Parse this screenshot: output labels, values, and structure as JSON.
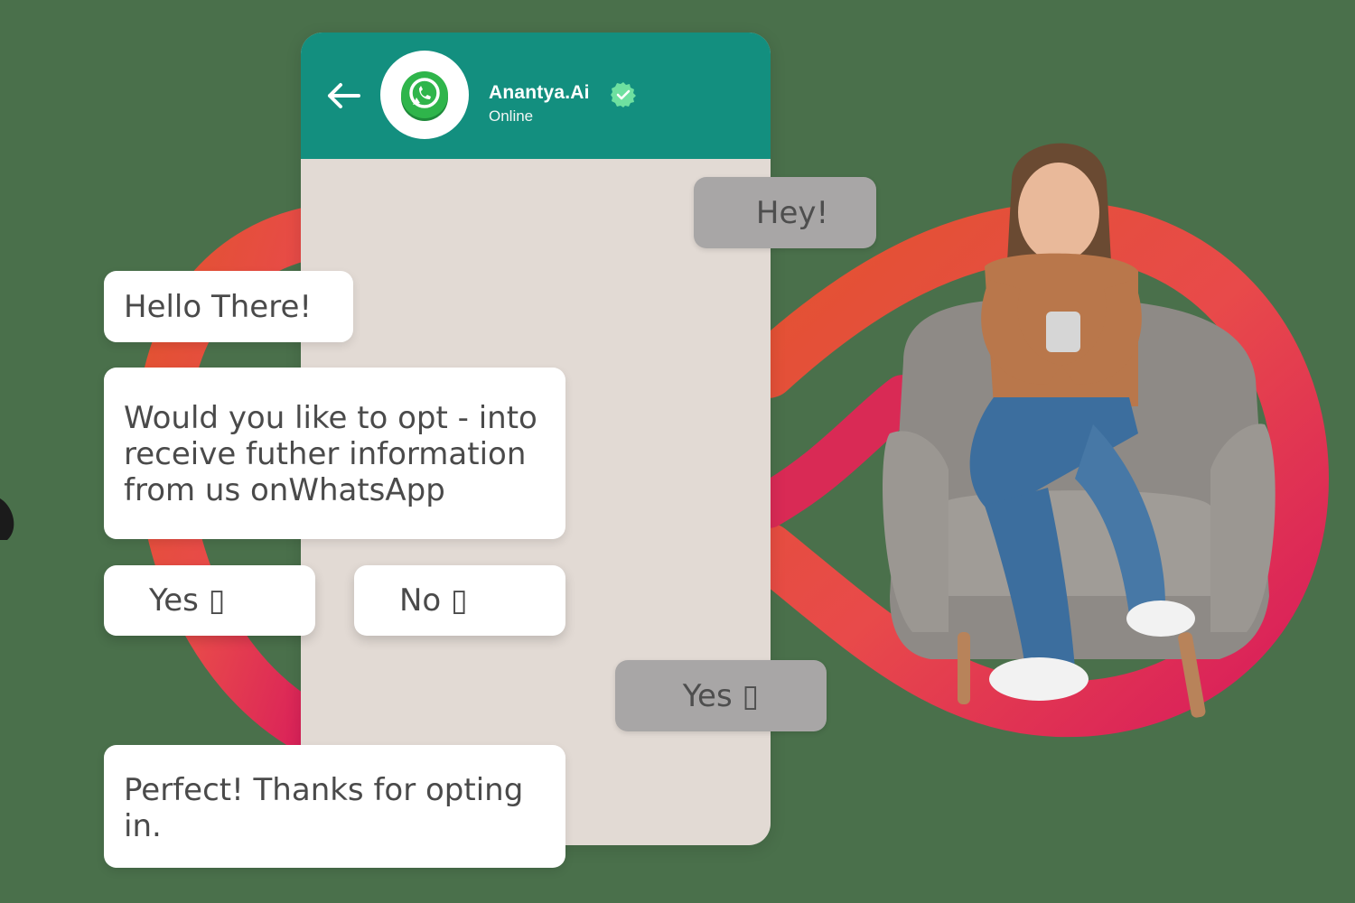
{
  "colors": {
    "background": "#4a704b",
    "header": "#138f7f",
    "chat_bg": "#e2dad4",
    "bubble_in": "#ffffff",
    "bubble_out": "#a8a6a6",
    "loop_start": "#e2532f",
    "loop_end": "#d81b5c",
    "verified": "#6ee0a0"
  },
  "header": {
    "back_icon": "arrow-left-icon",
    "avatar_icon": "whatsapp-logo",
    "contact_name": "Anantya.Ai",
    "verified_icon": "verified-check-icon",
    "status": "Online"
  },
  "messages": {
    "outgoing_1": "Hey!",
    "incoming_1": "Hello There!",
    "incoming_2": "Would you like to opt - into receive futher information from us onWhatsApp",
    "reply_yes": "Yes ▯",
    "reply_no": "No ▯",
    "outgoing_2": "Yes ▯",
    "incoming_3": "Perfect!  Thanks for opting in."
  },
  "illustration": {
    "subject": "woman-on-armchair-with-phone",
    "shape": "infinity-loop"
  }
}
